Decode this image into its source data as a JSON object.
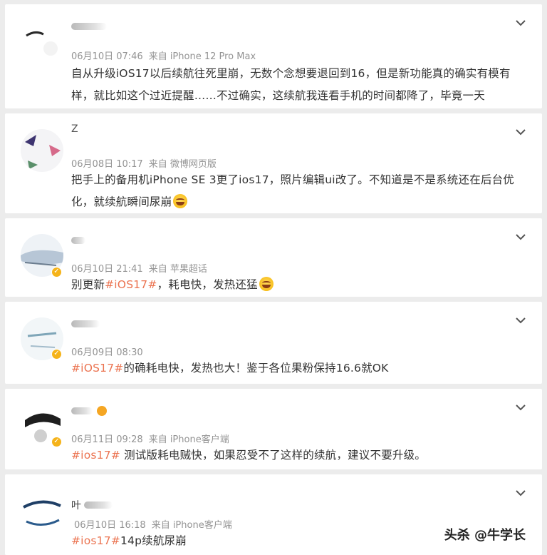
{
  "comments": [
    {
      "name_visible": "",
      "time": "06月10日 07:46",
      "source": "来自 iPhone 12 Pro Max",
      "text": "自从升级iOS17以后续航往死里崩，无数个念想要退回到16，但是新功能真的确实有模有样，就比如这个过近提醒……不过确实，这续航我连看手机的时间都降了，毕竟一天"
    },
    {
      "name_visible": "Z",
      "time": "06月08日 10:17",
      "source": "来自 微博网页版",
      "text": "把手上的备用机iPhone SE 3更了ios17，照片编辑ui改了。不知道是不是系统还在后台优化，就续航瞬间尿崩"
    },
    {
      "name_visible": "",
      "time": "06月10日 21:41",
      "source": "来自 苹果超话",
      "text_pre": "别更新",
      "tag": "#iOS17#",
      "text_post": "，耗电快，发热还猛"
    },
    {
      "name_visible": "",
      "time": "06月09日 08:30",
      "source": "",
      "tag": "#iOS17#",
      "text_post": "的确耗电快，发热也大！鉴于各位果粉保持16.6就OK"
    },
    {
      "name_visible": "",
      "time": "06月11日 09:28",
      "source": "来自 iPhone客户端",
      "tag": "#ios17#",
      "text_post": " 测试版耗电贼快，如果忍受不了这样的续航，建议不要升级。"
    },
    {
      "name_visible": "叶",
      "time": "06月10日 16:18",
      "source": "来自 iPhone客户端",
      "tag": "#ios17#",
      "text_post": "14p续航尿崩"
    }
  ],
  "watermark": "头杀 @牛学长",
  "colors": {
    "tag": "#eb7350",
    "meta": "#939393",
    "text": "#333333",
    "badge": "#f5b31a"
  },
  "icons": {
    "expand": "chevron-down-icon"
  }
}
